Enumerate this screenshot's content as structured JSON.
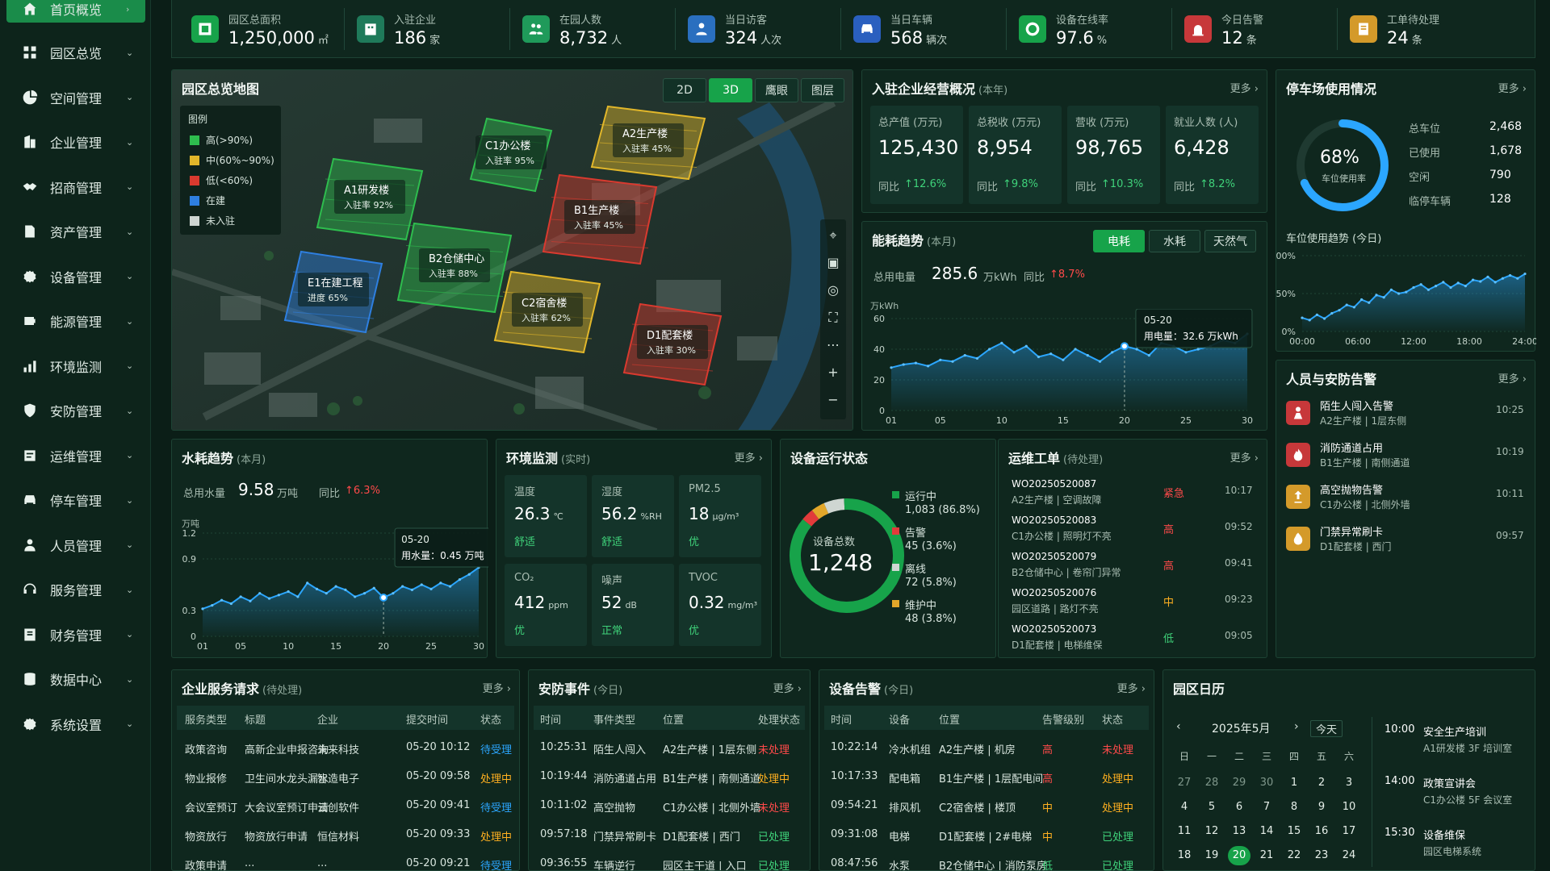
{
  "colors": {
    "accent": "#17a34a",
    "line": "#2ba6ff",
    "red": "#ff4a4a",
    "orange": "#ffb020",
    "green": "#3fd27a"
  },
  "sidebar": {
    "items": [
      {
        "label": "首页概览",
        "icon": "home-icon",
        "active": true
      },
      {
        "label": "园区总览",
        "icon": "grid-icon",
        "active": false
      },
      {
        "label": "空间管理",
        "icon": "pie-icon",
        "active": false
      },
      {
        "label": "企业管理",
        "icon": "building-icon",
        "active": false
      },
      {
        "label": "招商管理",
        "icon": "handshake-icon",
        "active": false
      },
      {
        "label": "资产管理",
        "icon": "asset-icon",
        "active": false
      },
      {
        "label": "设备管理",
        "icon": "gear-icon",
        "active": false
      },
      {
        "label": "能源管理",
        "icon": "battery-icon",
        "active": false
      },
      {
        "label": "环境监测",
        "icon": "bar-chart-icon",
        "active": false
      },
      {
        "label": "安防管理",
        "icon": "shield-icon",
        "active": false
      },
      {
        "label": "运维管理",
        "icon": "wrench-icon",
        "active": false
      },
      {
        "label": "停车管理",
        "icon": "car-icon",
        "active": false
      },
      {
        "label": "人员管理",
        "icon": "user-icon",
        "active": false
      },
      {
        "label": "服务管理",
        "icon": "service-icon",
        "active": false
      },
      {
        "label": "财务管理",
        "icon": "finance-icon",
        "active": false
      },
      {
        "label": "数据中心",
        "icon": "database-icon",
        "active": false
      },
      {
        "label": "系统设置",
        "icon": "settings-icon",
        "active": false
      }
    ]
  },
  "kpis": [
    {
      "label": "园区总面积",
      "value": "1,250,000",
      "unit": "㎡",
      "icon": "area-icon",
      "color": "#17a34a"
    },
    {
      "label": "入驻企业",
      "value": "186",
      "unit": "家",
      "icon": "company-icon",
      "color": "#1f7a5a"
    },
    {
      "label": "在园人数",
      "value": "8,732",
      "unit": "人",
      "icon": "people-icon",
      "color": "#1f9a5a"
    },
    {
      "label": "当日访客",
      "value": "324",
      "unit": "人次",
      "icon": "visitor-icon",
      "color": "#2a6fbf"
    },
    {
      "label": "当日车辆",
      "value": "568",
      "unit": "辆次",
      "icon": "car-icon",
      "color": "#2a5fbf"
    },
    {
      "label": "设备在线率",
      "value": "97.6",
      "unit": "%",
      "icon": "online-icon",
      "color": "#17a34a"
    },
    {
      "label": "今日告警",
      "value": "12",
      "unit": "条",
      "icon": "alarm-icon",
      "color": "#c7383a"
    },
    {
      "label": "工单待处理",
      "value": "24",
      "unit": "条",
      "icon": "ticket-icon",
      "color": "#d49a2a"
    }
  ],
  "map": {
    "title": "园区总览地图",
    "tabs": [
      "2D",
      "3D",
      "鹰眼",
      "图层"
    ],
    "active_tab": "3D",
    "legend_title": "图例",
    "legend": [
      {
        "label": "高(>90%)",
        "color": "#2ebd4e"
      },
      {
        "label": "中(60%~90%)",
        "color": "#e2b72a"
      },
      {
        "label": "低(<60%)",
        "color": "#d93a2f"
      },
      {
        "label": "在建",
        "color": "#2e7fe0"
      },
      {
        "label": "未入驻",
        "color": "#cfd6d2"
      }
    ],
    "buildings": [
      {
        "name": "C1办公楼",
        "rate": "入驻率 95%",
        "color": "#2ebd4e"
      },
      {
        "name": "A2生产楼",
        "rate": "入驻率 45%",
        "color": "#e2b72a"
      },
      {
        "name": "A1研发楼",
        "rate": "入驻率 92%",
        "color": "#2ebd4e"
      },
      {
        "name": "B1生产楼",
        "rate": "入驻率 45%",
        "color": "#d93a2f"
      },
      {
        "name": "B2仓储中心",
        "rate": "入驻率 88%",
        "color": "#2ebd4e"
      },
      {
        "name": "E1在建工程",
        "rate": "进度 65%",
        "color": "#2e7fe0"
      },
      {
        "name": "C2宿舍楼",
        "rate": "入驻率 62%",
        "color": "#e2b72a"
      },
      {
        "name": "D1配套楼",
        "rate": "入驻率 30%",
        "color": "#d93a2f"
      }
    ]
  },
  "enterprise": {
    "title": "入驻企业经营概况",
    "sub": "(本年)",
    "more": "更多",
    "cards": [
      {
        "label": "总产值 (万元)",
        "value": "125,430",
        "yoy": "同比",
        "change": "↑12.6%"
      },
      {
        "label": "总税收 (万元)",
        "value": "8,954",
        "yoy": "同比",
        "change": "↑9.8%"
      },
      {
        "label": "营收 (万元)",
        "value": "98,765",
        "yoy": "同比",
        "change": "↑10.3%"
      },
      {
        "label": "就业人数 (人)",
        "value": "6,428",
        "yoy": "同比",
        "change": "↑8.2%"
      }
    ]
  },
  "parking": {
    "title": "停车场使用情况",
    "more": "更多",
    "pct": "68%",
    "pct_label": "车位使用率",
    "ratio": 0.68,
    "stats": [
      {
        "label": "总车位",
        "value": "2,468"
      },
      {
        "label": "已使用",
        "value": "1,678"
      },
      {
        "label": "空闲",
        "value": "790"
      },
      {
        "label": "临停车辆",
        "value": "128"
      }
    ],
    "trend_title": "车位使用趋势 (今日)",
    "chart_data": {
      "type": "area",
      "x": [
        "00:00",
        "06:00",
        "12:00",
        "18:00",
        "24:00"
      ],
      "y_ticks": [
        "100%",
        "50%",
        "0%"
      ],
      "ylim": [
        0,
        100
      ],
      "values": [
        18,
        15,
        22,
        17,
        24,
        28,
        35,
        32,
        42,
        38,
        48,
        45,
        55,
        50,
        52,
        58,
        62,
        55,
        60,
        65,
        58,
        64,
        60,
        68,
        66,
        72,
        65,
        70,
        74,
        70,
        76
      ]
    }
  },
  "energy": {
    "title": "能耗趋势",
    "sub": "(本月)",
    "tabs": [
      "电耗",
      "水耗",
      "天然气"
    ],
    "active_tab": "电耗",
    "total_label": "总用电量",
    "total": "285.6",
    "total_unit": "万kWh",
    "yoy": "同比",
    "change": "↑8.7%",
    "unit": "万kWh",
    "tooltip_date": "05-20",
    "tooltip_text": "用电量：32.6 万kWh",
    "chart_data": {
      "type": "area",
      "x_ticks": [
        "01",
        "05",
        "10",
        "15",
        "20",
        "25",
        "30"
      ],
      "y_ticks": [
        "60",
        "40",
        "20",
        "0"
      ],
      "ylim": [
        0,
        60
      ],
      "values": [
        28,
        30,
        31,
        29,
        33,
        32,
        36,
        34,
        40,
        44,
        38,
        42,
        35,
        37,
        33,
        40,
        36,
        32,
        38,
        42,
        40,
        36,
        44,
        42,
        38,
        40,
        42,
        46,
        44,
        50
      ]
    }
  },
  "water": {
    "title": "水耗趋势",
    "sub": "(本月)",
    "total_label": "总用水量",
    "total": "9.58",
    "total_unit": "万吨",
    "yoy": "同比",
    "change": "↑6.3%",
    "unit": "万吨",
    "tooltip_date": "05-20",
    "tooltip_text": "用水量：0.45 万吨",
    "chart_data": {
      "type": "area",
      "x_ticks": [
        "01",
        "05",
        "10",
        "15",
        "20",
        "25",
        "30"
      ],
      "y_ticks": [
        "1.2",
        "0.9",
        "0.3",
        "0"
      ],
      "ylim": [
        0,
        1.2
      ],
      "values": [
        0.32,
        0.36,
        0.42,
        0.38,
        0.46,
        0.41,
        0.5,
        0.44,
        0.48,
        0.52,
        0.46,
        0.62,
        0.55,
        0.5,
        0.58,
        0.54,
        0.46,
        0.5,
        0.56,
        0.45,
        0.5,
        0.58,
        0.54,
        0.6,
        0.55,
        0.62,
        0.58,
        0.66,
        0.72,
        0.8
      ]
    }
  },
  "environment": {
    "title": "环境监测",
    "sub": "(实时)",
    "more": "更多",
    "cards": [
      {
        "label": "温度",
        "value": "26.3",
        "unit": "℃",
        "status": "舒适"
      },
      {
        "label": "湿度",
        "value": "56.2",
        "unit": "%RH",
        "status": "舒适"
      },
      {
        "label": "PM2.5",
        "value": "18",
        "unit": "μg/m³",
        "status": "优"
      },
      {
        "label": "CO₂",
        "value": "412",
        "unit": "ppm",
        "status": "优"
      },
      {
        "label": "噪声",
        "value": "52",
        "unit": "dB",
        "status": "正常"
      },
      {
        "label": "TVOC",
        "value": "0.32",
        "unit": "mg/m³",
        "status": "优"
      }
    ]
  },
  "devices": {
    "title": "设备运行状态",
    "total_label": "设备总数",
    "total": "1,248",
    "chart_data": {
      "type": "pie",
      "slices": [
        {
          "label": "运行中",
          "value": 1083,
          "text": "1,083 (86.8%)",
          "color": "#17a34a"
        },
        {
          "label": "告警",
          "value": 45,
          "text": "45 (3.6%)",
          "color": "#e23b3b"
        },
        {
          "label": "离线",
          "value": 72,
          "text": "72 (5.8%)",
          "color": "#cfd6d2"
        },
        {
          "label": "维护中",
          "value": 48,
          "text": "48 (3.8%)",
          "color": "#e2a72a"
        }
      ]
    }
  },
  "workorders": {
    "title": "运维工单",
    "sub": "(待处理)",
    "more": "更多",
    "rows": [
      {
        "id": "WO20250520087",
        "desc": "A2生产楼 | 空调故障",
        "level": "紧急",
        "time": "10:17",
        "color": "#ff4a4a"
      },
      {
        "id": "WO20250520083",
        "desc": "C1办公楼 | 照明灯不亮",
        "level": "高",
        "time": "09:52",
        "color": "#ff4a4a"
      },
      {
        "id": "WO20250520079",
        "desc": "B2仓储中心 | 卷帘门异常",
        "level": "高",
        "time": "09:41",
        "color": "#ff4a4a"
      },
      {
        "id": "WO20250520076",
        "desc": "园区道路 | 路灯不亮",
        "level": "中",
        "time": "09:23",
        "color": "#ffb020"
      },
      {
        "id": "WO20250520073",
        "desc": "D1配套楼 | 电梯维保",
        "level": "低",
        "time": "09:05",
        "color": "#3fd27a"
      }
    ]
  },
  "security_alerts": {
    "title": "人员与安防告警",
    "more": "更多",
    "rows": [
      {
        "title": "陌生人闯入告警",
        "loc": "A2生产楼 | 1层东侧",
        "time": "10:25",
        "icon": "intruder-icon",
        "color": "#c7383a"
      },
      {
        "title": "消防通道占用",
        "loc": "B1生产楼 | 南侧通道",
        "time": "10:19",
        "icon": "fire-icon",
        "color": "#c7383a"
      },
      {
        "title": "高空抛物告警",
        "loc": "C1办公楼 | 北侧外墙",
        "time": "10:11",
        "icon": "falling-icon",
        "color": "#d49a2a"
      },
      {
        "title": "门禁异常刷卡",
        "loc": "D1配套楼 | 西门",
        "time": "09:57",
        "icon": "card-icon",
        "color": "#d49a2a"
      }
    ]
  },
  "service_requests": {
    "title": "企业服务请求",
    "sub": "(待处理)",
    "more": "更多",
    "headers": [
      "服务类型",
      "标题",
      "企业",
      "提交时间",
      "状态"
    ],
    "rows": [
      {
        "cells": [
          "政策咨询",
          "高新企业申报咨询",
          "未来科技",
          "05-20 10:12",
          "待受理"
        ],
        "color": "#2ba6ff"
      },
      {
        "cells": [
          "物业报修",
          "卫生间水龙头漏水",
          "智造电子",
          "05-20 09:58",
          "处理中"
        ],
        "color": "#ffb020"
      },
      {
        "cells": [
          "会议室预订",
          "大会议室预订申请",
          "云创软件",
          "05-20 09:41",
          "待受理"
        ],
        "color": "#2ba6ff"
      },
      {
        "cells": [
          "物资放行",
          "物资放行申请",
          "恒信材料",
          "05-20 09:33",
          "处理中"
        ],
        "color": "#ffb020"
      },
      {
        "cells": [
          "政策申请",
          "...",
          "...",
          "05-20 09:21",
          "待受理"
        ],
        "color": "#2ba6ff"
      }
    ]
  },
  "security_events": {
    "title": "安防事件",
    "sub": "(今日)",
    "more": "更多",
    "headers": [
      "时间",
      "事件类型",
      "位置",
      "处理状态"
    ],
    "rows": [
      {
        "cells": [
          "10:25:31",
          "陌生人闯入",
          "A2生产楼 | 1层东侧",
          "未处理"
        ],
        "color": "#ff4a4a"
      },
      {
        "cells": [
          "10:19:44",
          "消防通道占用",
          "B1生产楼 | 南侧通道",
          "处理中"
        ],
        "color": "#ffb020"
      },
      {
        "cells": [
          "10:11:02",
          "高空抛物",
          "C1办公楼 | 北侧外墙",
          "未处理"
        ],
        "color": "#ff4a4a"
      },
      {
        "cells": [
          "09:57:18",
          "门禁异常刷卡",
          "D1配套楼 | 西门",
          "已处理"
        ],
        "color": "#3fd27a"
      },
      {
        "cells": [
          "09:36:55",
          "车辆逆行",
          "园区主干道 | 入口",
          "已处理"
        ],
        "color": "#3fd27a"
      }
    ]
  },
  "device_alarms": {
    "title": "设备告警",
    "sub": "(今日)",
    "more": "更多",
    "headers": [
      "时间",
      "设备",
      "位置",
      "告警级别",
      "状态"
    ],
    "rows": [
      {
        "cells": [
          "10:22:14",
          "冷水机组",
          "A2生产楼 | 机房",
          "高",
          "未处理"
        ],
        "lvl": "#ff4a4a",
        "color": "#ff4a4a"
      },
      {
        "cells": [
          "10:17:33",
          "配电箱",
          "B1生产楼 | 1层配电间",
          "高",
          "处理中"
        ],
        "lvl": "#ff4a4a",
        "color": "#ffb020"
      },
      {
        "cells": [
          "09:54:21",
          "排风机",
          "C2宿舍楼 | 楼顶",
          "中",
          "处理中"
        ],
        "lvl": "#ffb020",
        "color": "#ffb020"
      },
      {
        "cells": [
          "09:31:08",
          "电梯",
          "D1配套楼 | 2#电梯",
          "中",
          "已处理"
        ],
        "lvl": "#ffb020",
        "color": "#3fd27a"
      },
      {
        "cells": [
          "08:47:56",
          "水泵",
          "B2仓储中心 | 消防泵房",
          "低",
          "已处理"
        ],
        "lvl": "#3fd27a",
        "color": "#3fd27a"
      }
    ]
  },
  "calendar": {
    "title": "园区日历",
    "month": "2025年5月",
    "today_btn": "今天",
    "weekdays": [
      "日",
      "一",
      "二",
      "三",
      "四",
      "五",
      "六"
    ],
    "days": [
      "27",
      "28",
      "29",
      "30",
      "1",
      "2",
      "3",
      "4",
      "5",
      "6",
      "7",
      "8",
      "9",
      "10",
      "11",
      "12",
      "13",
      "14",
      "15",
      "16",
      "17",
      "18",
      "19",
      "20",
      "21",
      "22",
      "23",
      "24"
    ],
    "today": "20",
    "events": [
      {
        "time": "10:00",
        "title": "安全生产培训",
        "loc": "A1研发楼 3F 培训室"
      },
      {
        "time": "14:00",
        "title": "政策宣讲会",
        "loc": "C1办公楼 5F 会议室"
      },
      {
        "time": "15:30",
        "title": "设备维保",
        "loc": "园区电梯系统"
      }
    ]
  }
}
